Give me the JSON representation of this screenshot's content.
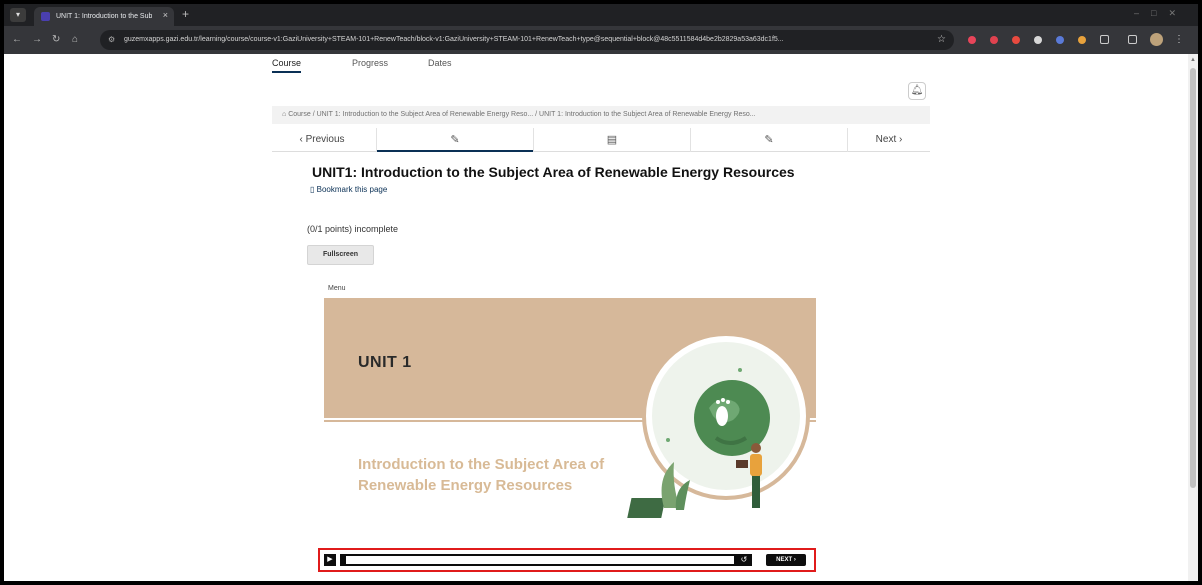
{
  "browser": {
    "tab_title": "UNIT 1: Introduction to the Sub",
    "tab_close": "×",
    "new_tab": "+",
    "url": "guzemxapps.gazi.edu.tr/learning/course/course-v1:GaziUniversity+STEAM-101+RenewTeach/block-v1:GaziUniversity+STEAM-101+RenewTeach+type@sequential+block@48c5511584d4be2b2829a53a63dc1f5...",
    "ext_colors": [
      "#e8455a",
      "#e0424f",
      "#e84a3f",
      "#d8d8d8",
      "#5a7ad8",
      "#e8a23c"
    ]
  },
  "course_tabs": [
    {
      "label": "Course",
      "active": true
    },
    {
      "label": "Progress",
      "active": false
    },
    {
      "label": "Dates",
      "active": false
    }
  ],
  "breadcrumb": "Course / UNIT 1: Introduction to the Subject Area of Renewable Energy Reso...  / UNIT 1: Introduction to the Subject Area of Renewable Energy Reso...",
  "sequence_nav": {
    "previous": "Previous",
    "next": "Next"
  },
  "unit": {
    "title": "UNIT1: Introduction to the Subject Area of Renewable Energy Resources",
    "bookmark": "Bookmark this page",
    "points": "(0/1 points) incomplete",
    "fullscreen": "Fullscreen",
    "menu": "Menu"
  },
  "slide": {
    "heading": "UNIT 1",
    "subtitle": "Introduction to the Subject Area of Renewable Energy Resources"
  },
  "player": {
    "next": "NEXT",
    "progress_fraction": 0.0
  }
}
